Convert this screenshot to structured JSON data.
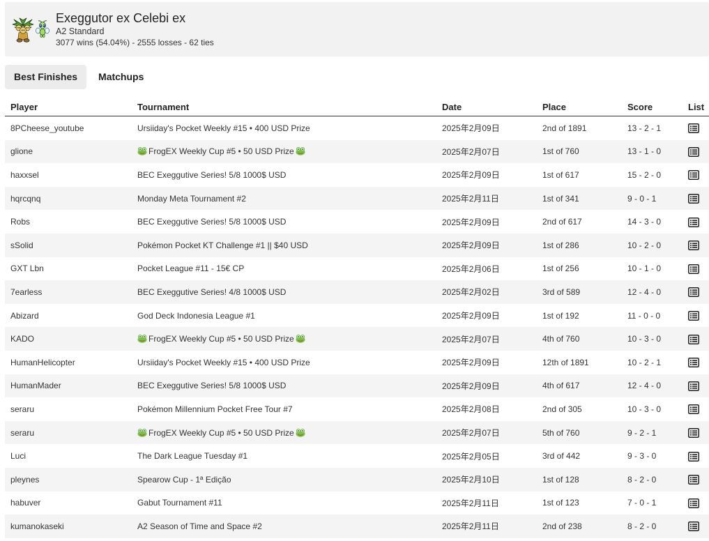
{
  "deck": {
    "title": "Exeggutor ex Celebi ex",
    "format": "A2 Standard",
    "record": "3077 wins (54.04%) - 2555 losses - 62 ties",
    "sprites": [
      "exeggutor-sprite",
      "celebi-sprite"
    ]
  },
  "tabs": [
    {
      "label": "Best Finishes",
      "active": true
    },
    {
      "label": "Matchups",
      "active": false
    }
  ],
  "table": {
    "columns": [
      "Player",
      "Tournament",
      "Date",
      "Place",
      "Score",
      "List"
    ],
    "rows": [
      {
        "player": "8PCheese_youtube",
        "tournament": "Ursiiday's Pocket Weekly #15 • 400 USD Prize",
        "date": "2025年2月09日",
        "place": "2nd of 1891",
        "score": "13 - 2 - 1",
        "list_icon": "decklist-icon"
      },
      {
        "player": "glione",
        "tournament": "FrogEX Weekly Cup #5 • 50 USD Prize",
        "leading_icon": "frog-icon",
        "trailing_icon": "frog-icon",
        "date": "2025年2月07日",
        "place": "1st of 760",
        "score": "13 - 1 - 0",
        "list_icon": "decklist-icon"
      },
      {
        "player": "haxxsel",
        "tournament": "BEC Exeggutive Series! 5/8 1000$ USD",
        "date": "2025年2月09日",
        "place": "1st of 617",
        "score": "15 - 2 - 0",
        "list_icon": "decklist-icon"
      },
      {
        "player": "hqrcqnq",
        "tournament": "Monday Meta Tournament #2",
        "date": "2025年2月11日",
        "place": "1st of 341",
        "score": "9 - 0 - 1",
        "list_icon": "decklist-icon"
      },
      {
        "player": "Robs",
        "tournament": "BEC Exeggutive Series! 5/8 1000$ USD",
        "date": "2025年2月09日",
        "place": "2nd of 617",
        "score": "14 - 3 - 0",
        "list_icon": "decklist-icon"
      },
      {
        "player": "sSolid",
        "tournament": "Pokémon Pocket KT Challenge #1 || $40 USD",
        "date": "2025年2月09日",
        "place": "1st of 286",
        "score": "10 - 2 - 0",
        "list_icon": "decklist-icon"
      },
      {
        "player": "GXT Lbn",
        "tournament": "Pocket League #11 - 15€ CP",
        "date": "2025年2月06日",
        "place": "1st of 256",
        "score": "10 - 1 - 0",
        "list_icon": "decklist-icon"
      },
      {
        "player": "7earless",
        "tournament": "BEC Exeggutive Series! 4/8 1000$ USD",
        "date": "2025年2月02日",
        "place": "3rd of 589",
        "score": "12 - 4 - 0",
        "list_icon": "decklist-icon"
      },
      {
        "player": "Abizard",
        "tournament": "God Deck Indonesia League #1",
        "date": "2025年2月09日",
        "place": "1st of 192",
        "score": "11 - 0 - 0",
        "list_icon": "decklist-icon"
      },
      {
        "player": "KADO",
        "tournament": "FrogEX Weekly Cup #5 • 50 USD Prize",
        "leading_icon": "frog-icon",
        "trailing_icon": "frog-icon",
        "date": "2025年2月07日",
        "place": "4th of 760",
        "score": "10 - 3 - 0",
        "list_icon": "decklist-icon"
      },
      {
        "player": "HumanHelicopter",
        "tournament": "Ursiiday's Pocket Weekly #15 • 400 USD Prize",
        "date": "2025年2月09日",
        "place": "12th of 1891",
        "score": "10 - 2 - 1",
        "list_icon": "decklist-icon"
      },
      {
        "player": "HumanMader",
        "tournament": "BEC Exeggutive Series! 5/8 1000$ USD",
        "date": "2025年2月09日",
        "place": "4th of 617",
        "score": "12 - 4 - 0",
        "list_icon": "decklist-icon"
      },
      {
        "player": "seraru",
        "tournament": "Pokémon Millennium Pocket Free Tour #7",
        "date": "2025年2月08日",
        "place": "2nd of 305",
        "score": "10 - 3 - 0",
        "list_icon": "decklist-icon"
      },
      {
        "player": "seraru",
        "tournament": "FrogEX Weekly Cup #5 • 50 USD Prize",
        "leading_icon": "frog-icon",
        "trailing_icon": "frog-icon",
        "date": "2025年2月07日",
        "place": "5th of 760",
        "score": "9 - 2 - 1",
        "list_icon": "decklist-icon"
      },
      {
        "player": "Luci",
        "tournament": "The Dark League Tuesday #1",
        "date": "2025年2月05日",
        "place": "3rd of 442",
        "score": "9 - 3 - 0",
        "list_icon": "decklist-icon"
      },
      {
        "player": "pleynes",
        "tournament": "Spearow Cup - 1ª Edição",
        "date": "2025年2月10日",
        "place": "1st of 128",
        "score": "8 - 2 - 0",
        "list_icon": "decklist-icon"
      },
      {
        "player": "habuver",
        "tournament": "Gabut Tournament #11",
        "date": "2025年2月11日",
        "place": "1st of 123",
        "score": "7 - 0 - 1",
        "list_icon": "decklist-icon"
      },
      {
        "player": "kumanokaseki",
        "tournament": "A2 Season of Time and Space #2",
        "date": "2025年2月11日",
        "place": "2nd of 238",
        "score": "8 - 2 - 0",
        "list_icon": "decklist-icon"
      }
    ]
  },
  "colors": {
    "header_bg": "#f2f2f2",
    "tab_active_bg": "#ececec",
    "row_stripe": "#f4f4f4",
    "text": "#333333",
    "heading_text": "#222222"
  }
}
